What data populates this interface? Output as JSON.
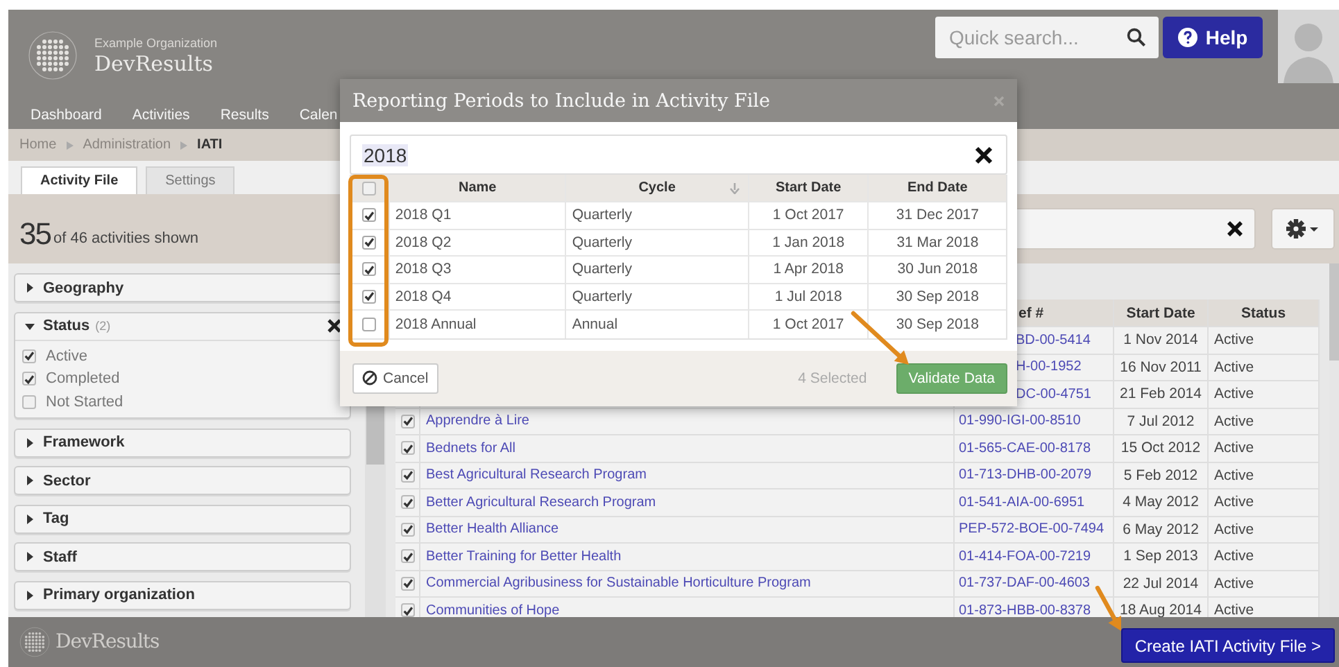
{
  "header": {
    "organization": "Example Organization",
    "app_name": "DevResults",
    "search": {
      "placeholder": "Quick search..."
    },
    "help_button": "Help",
    "nav": [
      {
        "label": "Dashboard"
      },
      {
        "label": "Activities"
      },
      {
        "label": "Results"
      },
      {
        "label": "Calen"
      }
    ]
  },
  "breadcrumb": [
    {
      "label": "Home",
      "current": false
    },
    {
      "label": "Administration",
      "current": false
    },
    {
      "label": "IATI",
      "current": true
    }
  ],
  "tabs": [
    {
      "label": "Activity File",
      "selected": true
    },
    {
      "label": "Settings",
      "selected": false
    }
  ],
  "summary": {
    "count": "35",
    "text": "of 46 activities shown"
  },
  "filters": [
    {
      "label": "Geography",
      "expanded": false
    },
    {
      "label": "Status",
      "count": "(2)",
      "expanded": true,
      "options": [
        {
          "label": "Active",
          "checked": true
        },
        {
          "label": "Completed",
          "checked": true
        },
        {
          "label": "Not Started",
          "checked": false
        }
      ]
    },
    {
      "label": "Framework",
      "expanded": false
    },
    {
      "label": "Sector",
      "expanded": false
    },
    {
      "label": "Tag",
      "expanded": false
    },
    {
      "label": "Staff",
      "expanded": false
    },
    {
      "label": "Primary organization",
      "expanded": false
    }
  ],
  "table": {
    "columns": [
      "ef #",
      "Start Date",
      "Status"
    ],
    "rows": [
      {
        "kind": "covered",
        "ref": "BD-00-5414",
        "start": "1 Nov 2014",
        "status": "Active"
      },
      {
        "kind": "covered",
        "ref": "H-00-1952",
        "start": "16 Nov 2011",
        "status": "Active"
      },
      {
        "kind": "covered",
        "ref": "DC-00-4751",
        "start": "21 Feb 2014",
        "status": "Active"
      },
      {
        "kind": "full",
        "checked": true,
        "name": "Apprendre à Lire",
        "ref": "01-990-IGI-00-8510",
        "start": "7 Jul 2012",
        "status": "Active"
      },
      {
        "kind": "full",
        "checked": true,
        "name": "Bednets for All",
        "ref": "01-565-CAE-00-8178",
        "start": "15 Oct 2012",
        "status": "Active"
      },
      {
        "kind": "full",
        "checked": true,
        "name": "Best Agricultural Research Program",
        "ref": "01-713-DHB-00-2079",
        "start": "5 Feb 2012",
        "status": "Active"
      },
      {
        "kind": "full",
        "checked": true,
        "name": "Better Agricultural Research Program",
        "ref": "01-541-AIA-00-6951",
        "start": "4 May 2012",
        "status": "Active"
      },
      {
        "kind": "full",
        "checked": true,
        "name": "Better Health Alliance",
        "ref": "PEP-572-BOE-00-7494",
        "start": "6 May 2012",
        "status": "Active"
      },
      {
        "kind": "full",
        "checked": true,
        "name": "Better Training for Better Health",
        "ref": "01-414-FOA-00-7219",
        "start": "1 Sep 2013",
        "status": "Active"
      },
      {
        "kind": "full",
        "checked": true,
        "name": "Commercial Agribusiness for Sustainable Horticulture Program",
        "ref": "01-737-DAF-00-4603",
        "start": "22 Jul 2014",
        "status": "Active"
      },
      {
        "kind": "full",
        "checked": true,
        "name": "Communities of Hope",
        "ref": "01-873-HBB-00-8378",
        "start": "18 Aug 2014",
        "status": "Active"
      }
    ]
  },
  "modal": {
    "title": "Reporting Periods to Include in Activity File",
    "search_value": "2018",
    "columns": [
      "Name",
      "Cycle",
      "Start Date",
      "End Date"
    ],
    "select_all_checked": false,
    "rows": [
      {
        "checked": true,
        "name": "2018 Q1",
        "cycle": "Quarterly",
        "start": "1 Oct 2017",
        "end": "31 Dec 2017"
      },
      {
        "checked": true,
        "name": "2018 Q2",
        "cycle": "Quarterly",
        "start": "1 Jan 2018",
        "end": "31 Mar 2018"
      },
      {
        "checked": true,
        "name": "2018 Q3",
        "cycle": "Quarterly",
        "start": "1 Apr 2018",
        "end": "30 Jun 2018"
      },
      {
        "checked": true,
        "name": "2018 Q4",
        "cycle": "Quarterly",
        "start": "1 Jul 2018",
        "end": "30 Sep 2018"
      },
      {
        "checked": false,
        "name": "2018 Annual",
        "cycle": "Annual",
        "start": "1 Oct 2017",
        "end": "30 Sep 2018"
      }
    ],
    "cancel": "Cancel",
    "selected_count": "4 Selected",
    "validate": "Validate Data"
  },
  "footer": {
    "app_name": "DevResults",
    "create_button": "Create IATI Activity File >"
  }
}
